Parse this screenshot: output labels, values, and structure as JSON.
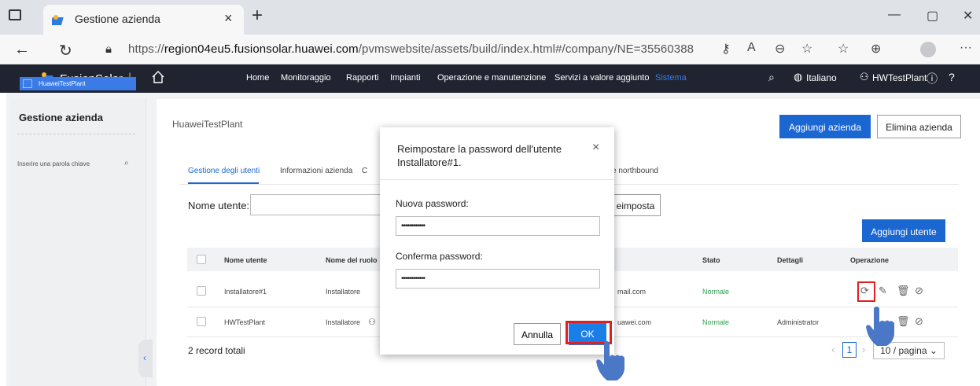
{
  "browser": {
    "tab_title": "Gestione azienda",
    "tab_close": "×",
    "new_tab": "+",
    "url_prefix": "https://",
    "url_host": "region04eu5.fusionsolar.huawei.com",
    "url_path": "/pvmswebsite/assets/build/index.html#/company/NE=35560388",
    "window_buttons": [
      "—",
      "▢",
      "✕"
    ]
  },
  "app_header": {
    "brand": "FusionSolar",
    "separator": "|",
    "menu": [
      "Home",
      "Monitoraggio",
      "Rapporti",
      "Impianti",
      "Operazione e manutenzione",
      "Servizi a valore aggiunto",
      "Sistema"
    ],
    "active_menu": "Sistema",
    "language": "Italiano",
    "user": "HWTestPlant"
  },
  "sidebar": {
    "title": "Gestione azienda",
    "search_placeholder": "Inserire una parola chiave",
    "items": [
      "HuaweiTestPlant"
    ]
  },
  "main": {
    "breadcrumb": "HuaweiTestPlant",
    "add_company": "Aggiungi azienda",
    "delete_company": "Elimina azienda",
    "tabs": [
      "Gestione degli utenti",
      "Informazioni azienda",
      "C",
      "e northbound"
    ],
    "username_label": "Nome utente:",
    "reset_button": "eimposta",
    "add_user": "Aggiungi utente",
    "table": {
      "headers": [
        "Nome utente",
        "Nome del ruolo",
        "Stato",
        "Dettagli",
        "Operazione"
      ],
      "rows": [
        {
          "user": "Installatore#1",
          "role": "Installatore",
          "email": "mail.com",
          "status": "Normale",
          "details": ""
        },
        {
          "user": "HWTestPlant",
          "role": "Installatore",
          "email": "uawei.com",
          "status": "Normale",
          "details": "Administrator"
        }
      ]
    },
    "total": "2 record totali",
    "pager": {
      "current": "1",
      "per_page": "10 / pagina"
    }
  },
  "modal": {
    "title": "Reimpostare la password dell'utente Installatore#1.",
    "close": "×",
    "new_password_label": "Nuova password:",
    "new_password_value": "••••••••••••",
    "confirm_password_label": "Conferma password:",
    "confirm_password_value": "••••••••••••",
    "cancel": "Annulla",
    "ok": "OK"
  },
  "colors": {
    "primary": "#1a67d2",
    "header_bg": "#1f2430",
    "highlight": "#e02020",
    "status_green": "#2e9e4c"
  }
}
